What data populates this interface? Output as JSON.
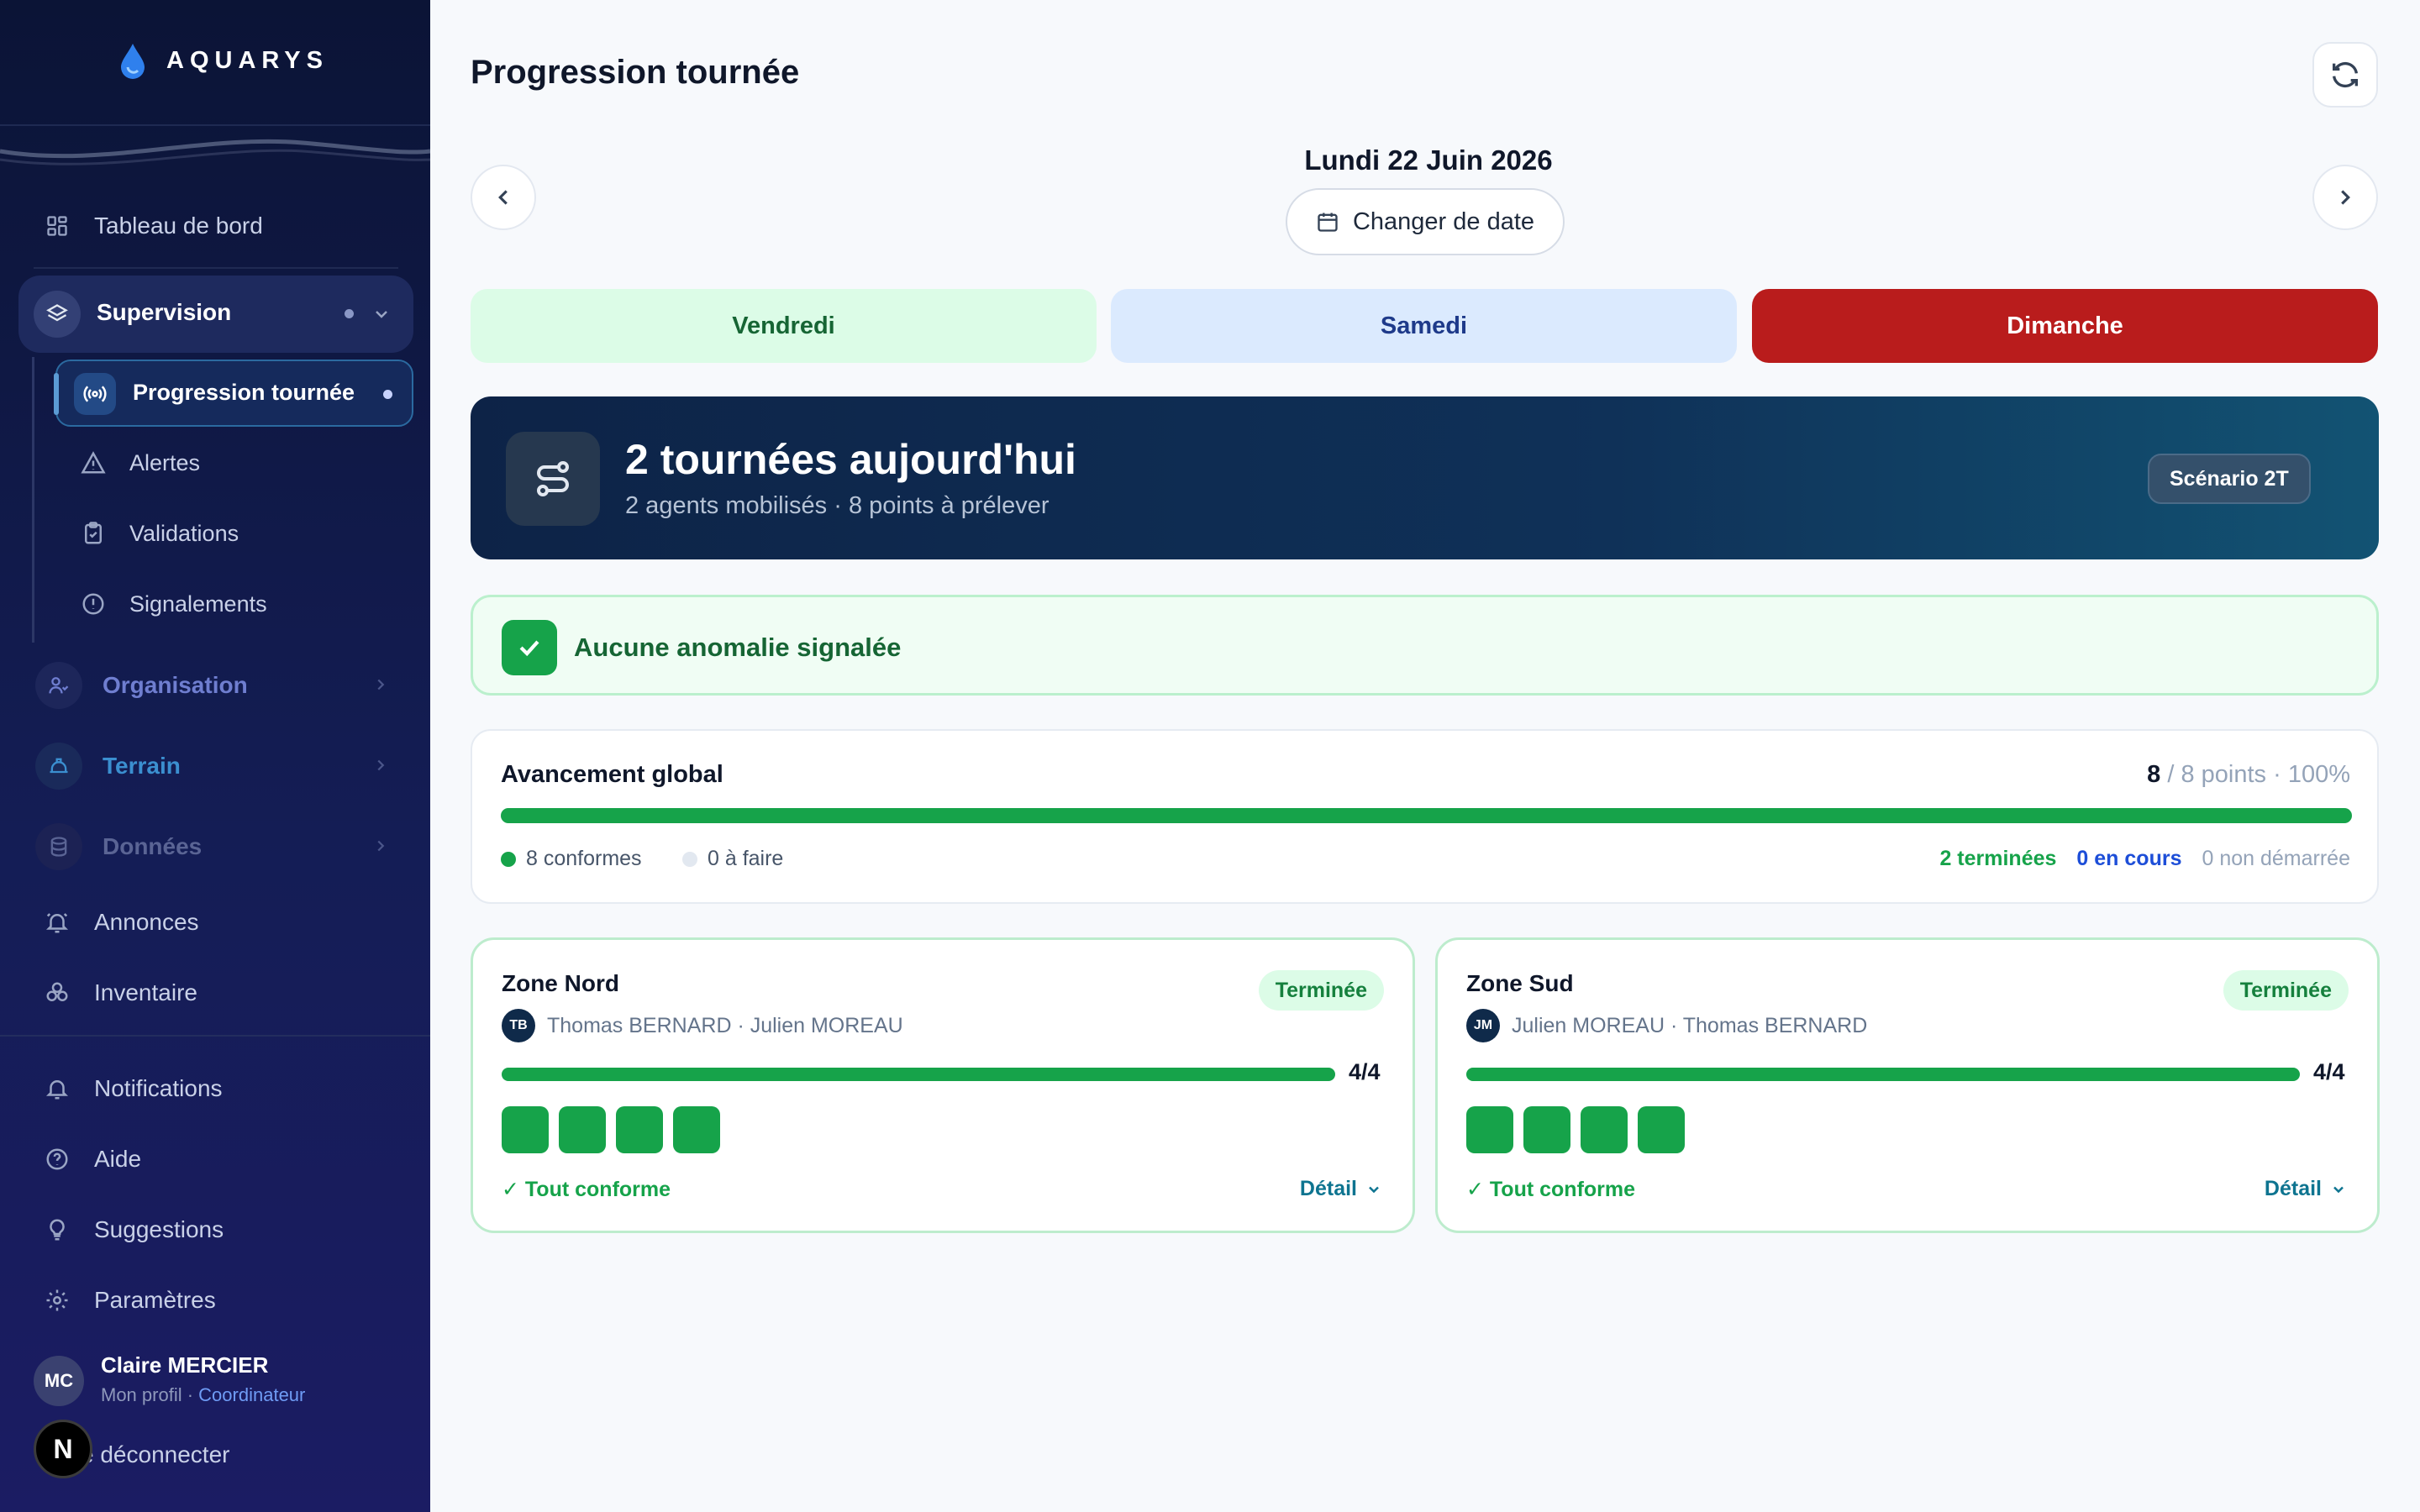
{
  "app": {
    "name": "AQUARYS"
  },
  "sidebar": {
    "dashboard": "Tableau de bord",
    "supervision": "Supervision",
    "progression": "Progression tournée",
    "alertes": "Alertes",
    "validations": "Validations",
    "signalements": "Signalements",
    "organisation": "Organisation",
    "terrain": "Terrain",
    "donnees": "Données",
    "annonces": "Annonces",
    "inventaire": "Inventaire",
    "notifications": "Notifications",
    "aide": "Aide",
    "suggestions": "Suggestions",
    "parametres": "Paramètres",
    "user": {
      "initials": "MC",
      "name": "Claire MERCIER",
      "profile": "Mon profil",
      "role": "Coordinateur"
    },
    "logout": "e déconnecter",
    "floating_badge": "N"
  },
  "header": {
    "title": "Progression tournée"
  },
  "date_nav": {
    "date": "Lundi 22 Juin 2026",
    "change_label": "Changer de date"
  },
  "days": [
    {
      "label": "Vendredi",
      "color": "#dcfce7"
    },
    {
      "label": "Samedi",
      "color": "#dbeafe"
    },
    {
      "label": "Dimanche",
      "color": "#b91c1c"
    }
  ],
  "summary": {
    "title": "2 tournées aujourd'hui",
    "subtitle": "2 agents mobilisés · 8 points à prélever",
    "scenario": "Scénario 2T"
  },
  "anomaly": {
    "text": "Aucune anomalie signalée"
  },
  "progress": {
    "title": "Avancement global",
    "done": "8",
    "rest": "/ 8 points · 100%",
    "percent": 100,
    "legend_conformes": "8 conformes",
    "legend_a_faire": "0 à faire",
    "terminees": "2 terminées",
    "en_cours": "0 en cours",
    "non_demarree": "0 non démarrée"
  },
  "zones": [
    {
      "name": "Zone Nord",
      "status": "Terminée",
      "initials": "TB",
      "agents": "Thomas BERNARD · Julien MOREAU",
      "count": "4/4",
      "percent": 100,
      "conform": "✓ Tout conforme",
      "detail": "Détail"
    },
    {
      "name": "Zone Sud",
      "status": "Terminée",
      "initials": "JM",
      "agents": "Julien MOREAU · Thomas BERNARD",
      "count": "4/4",
      "percent": 100,
      "conform": "✓ Tout conforme",
      "detail": "Détail"
    }
  ],
  "colors": {
    "accent_green": "#16a34a",
    "navy": "#0f2a4a",
    "link_blue": "#1d4ed8",
    "teal": "#0e7490"
  }
}
